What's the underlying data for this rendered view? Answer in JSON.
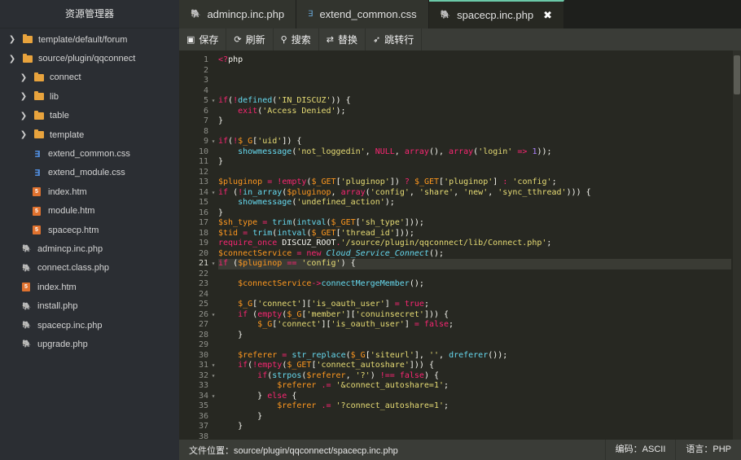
{
  "sidebar": {
    "title": "资源管理器",
    "items": [
      {
        "label": "template/default/forum",
        "type": "folder",
        "level": "l0",
        "icon": "folder-icon"
      },
      {
        "label": "source/plugin/qqconnect",
        "type": "folder",
        "level": "l0",
        "icon": "folder-icon"
      },
      {
        "label": "connect",
        "type": "folder",
        "level": "l1",
        "icon": "folder-icon"
      },
      {
        "label": "lib",
        "type": "folder",
        "level": "l1",
        "icon": "folder-icon"
      },
      {
        "label": "table",
        "type": "folder",
        "level": "l1",
        "icon": "folder-icon"
      },
      {
        "label": "template",
        "type": "folder",
        "level": "l1",
        "icon": "folder-icon"
      },
      {
        "label": "extend_common.css",
        "type": "css",
        "level": "l1f",
        "icon": "css-file-icon"
      },
      {
        "label": "extend_module.css",
        "type": "css",
        "level": "l1f",
        "icon": "css-file-icon"
      },
      {
        "label": "index.htm",
        "type": "html",
        "level": "l1f",
        "icon": "html-file-icon"
      },
      {
        "label": "module.htm",
        "type": "html",
        "level": "l1f",
        "icon": "html-file-icon"
      },
      {
        "label": "spacecp.htm",
        "type": "html",
        "level": "l1f",
        "icon": "html-file-icon"
      },
      {
        "label": "admincp.inc.php",
        "type": "php",
        "level": "l0f",
        "icon": "php-file-icon"
      },
      {
        "label": "connect.class.php",
        "type": "php",
        "level": "l0f",
        "icon": "php-file-icon"
      },
      {
        "label": "index.htm",
        "type": "html",
        "level": "l0f",
        "icon": "html-file-icon"
      },
      {
        "label": "install.php",
        "type": "php",
        "level": "l0f",
        "icon": "php-file-icon"
      },
      {
        "label": "spacecp.inc.php",
        "type": "php",
        "level": "l0f",
        "icon": "php-file-icon"
      },
      {
        "label": "upgrade.php",
        "type": "php",
        "level": "l0f",
        "icon": "php-file-icon"
      }
    ]
  },
  "tabs": [
    {
      "label": "admincp.inc.php",
      "icon": "php-file-icon",
      "active": false
    },
    {
      "label": "extend_common.css",
      "icon": "css-file-icon",
      "active": false
    },
    {
      "label": "spacecp.inc.php",
      "icon": "php-file-icon",
      "active": true,
      "close": "✖"
    }
  ],
  "toolbar": {
    "save": "保存",
    "refresh": "刷新",
    "search": "搜索",
    "replace": "替换",
    "goto": "跳转行"
  },
  "editor": {
    "highlight_line": 21,
    "fold_lines": [
      5,
      9,
      14,
      21,
      26,
      31,
      32,
      34
    ],
    "lines": [
      "<?php",
      "",
      "",
      "",
      "if(!defined('IN_DISCUZ')) {",
      "    exit('Access Denied');",
      "}",
      "",
      "if(!$_G['uid']) {",
      "    showmessage('not_loggedin', NULL, array(), array('login' => 1));",
      "}",
      "",
      "$pluginop = !empty($_GET['pluginop']) ? $_GET['pluginop'] : 'config';",
      "if (!in_array($pluginop, array('config', 'share', 'new', 'sync_tthread'))) {",
      "    showmessage('undefined_action');",
      "}",
      "$sh_type = trim(intval($_GET['sh_type']));",
      "$tid = trim(intval($_GET['thread_id']));",
      "require_once DISCUZ_ROOT.'/source/plugin/qqconnect/lib/Connect.php';",
      "$connectService = new Cloud_Service_Connect();",
      "if ($pluginop == 'config') {",
      "",
      "    $connectService->connectMergeMember();",
      "",
      "    $_G['connect']['is_oauth_user'] = true;",
      "    if (empty($_G['member']['conuinsecret'])) {",
      "        $_G['connect']['is_oauth_user'] = false;",
      "    }",
      "",
      "    $referer = str_replace($_G['siteurl'], '', dreferer());",
      "    if(!empty($_GET['connect_autoshare'])) {",
      "        if(strpos($referer, '?') !== false) {",
      "            $referer .= '&connect_autoshare=1';",
      "        } else {",
      "            $referer .= '?connect_autoshare=1';",
      "        }",
      "    }",
      ""
    ]
  },
  "status": {
    "path": "文件位置：source/plugin/qqconnect/spacecp.inc.php",
    "encoding": "编码：ASCII",
    "language": "语言：PHP"
  },
  "colors": {
    "keyword": "#f92672",
    "string": "#e6db74",
    "variable": "#fd971f",
    "function": "#66d9ef",
    "number": "#ae81ff",
    "text": "#f8f8f2"
  }
}
